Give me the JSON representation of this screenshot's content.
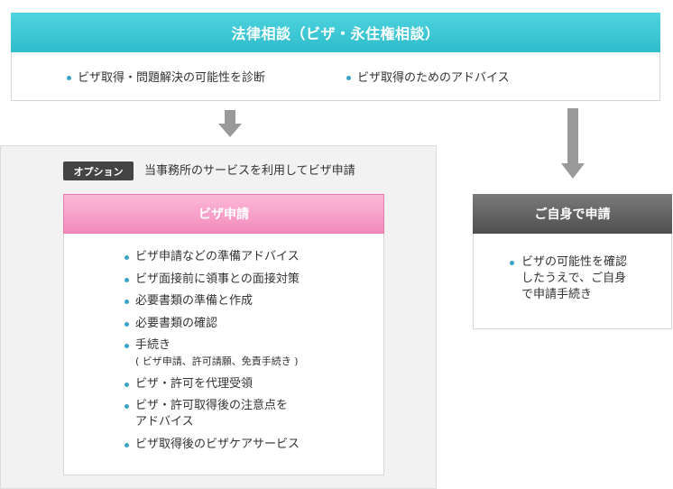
{
  "consultation": {
    "title": "法律相談（ビザ・永住権相談）",
    "items": [
      "ビザ取得・問題解決の可能性を診断",
      "ビザ取得のためのアドバイス"
    ]
  },
  "option": {
    "badge": "オプション",
    "description": "当事務所のサービスを利用してビザ申請"
  },
  "visa_application": {
    "title": "ビザ申請",
    "items": [
      {
        "text": "ビザ申請などの準備アドバイス"
      },
      {
        "text": "ビザ面接前に領事との面接対策"
      },
      {
        "text": "必要書類の準備と作成"
      },
      {
        "text": "必要書類の確認"
      },
      {
        "text": "手続き",
        "sub": "( ビザ申請、許可請願、免責手続き )"
      },
      {
        "text": "ビザ・許可を代理受領"
      },
      {
        "text": "ビザ・許可取得後の注意点を\nアドバイス"
      },
      {
        "text": "ビザ取得後のビザケアサービス"
      }
    ]
  },
  "self_application": {
    "title": "ご自身で申請",
    "description": "ビザの可能性を確認\nしたうえで、ご自身\nで申請手続き"
  },
  "colors": {
    "teal_header": "#2fbccb",
    "pink_header": "#f38bbd",
    "gray_header": "#4f4f4f",
    "bullet": "#3aa3c8",
    "arrow": "#9a9a9a"
  }
}
